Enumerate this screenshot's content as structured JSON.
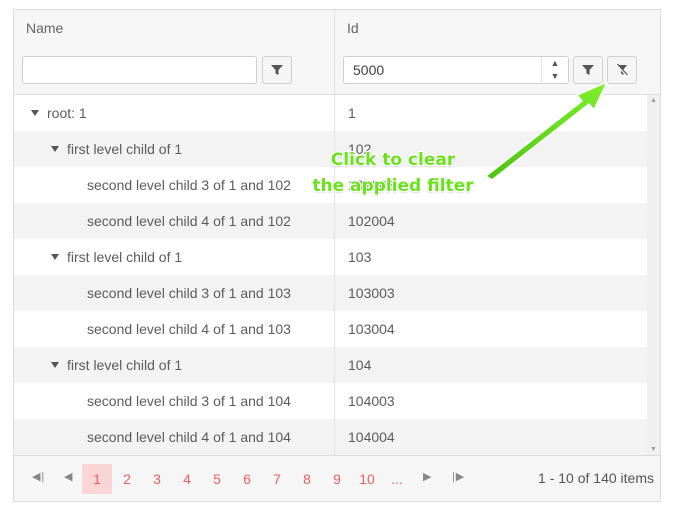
{
  "columns": {
    "name": "Name",
    "id": "Id"
  },
  "filters": {
    "name_value": "",
    "id_value": "5000"
  },
  "rows": [
    {
      "label": "root: 1",
      "id": "1",
      "level": 0,
      "expanded": true
    },
    {
      "label": "first level child of 1",
      "id": "102",
      "level": 1,
      "expanded": true
    },
    {
      "label": "second level child 3 of 1 and 102",
      "id": "102003",
      "level": 2
    },
    {
      "label": "second level child 4 of 1 and 102",
      "id": "102004",
      "level": 2
    },
    {
      "label": "first level child of 1",
      "id": "103",
      "level": 1,
      "expanded": true
    },
    {
      "label": "second level child 3 of 1 and 103",
      "id": "103003",
      "level": 2
    },
    {
      "label": "second level child 4 of 1 and 103",
      "id": "103004",
      "level": 2
    },
    {
      "label": "first level child of 1",
      "id": "104",
      "level": 1,
      "expanded": true
    },
    {
      "label": "second level child 3 of 1 and 104",
      "id": "104003",
      "level": 2
    },
    {
      "label": "second level child 4 of 1 and 104",
      "id": "104004",
      "level": 2
    }
  ],
  "pager": {
    "pages": [
      "1",
      "2",
      "3",
      "4",
      "5",
      "6",
      "7",
      "8",
      "9",
      "10",
      "..."
    ],
    "current": "1",
    "info": "1 - 10 of 140 items"
  },
  "callout": {
    "line1": "Click to clear",
    "line2": "the applied filter"
  },
  "colors": {
    "accent": "#e85f5f",
    "callout": "#6ce21d"
  },
  "icons": [
    "filter-icon",
    "clear-filter-icon",
    "spin-up-icon",
    "spin-down-icon",
    "expand-caret-icon",
    "first-page-icon",
    "prev-page-icon",
    "next-page-icon",
    "last-page-icon"
  ]
}
